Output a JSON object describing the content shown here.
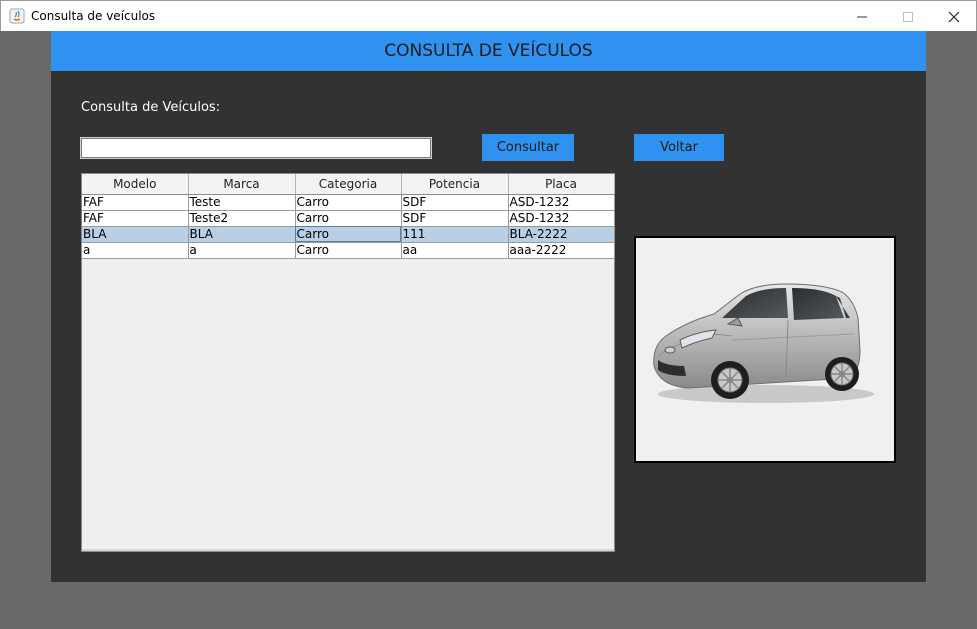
{
  "window": {
    "title": "Consulta de veículos"
  },
  "header": {
    "title": "CONSULTA DE VEÍCULOS"
  },
  "form": {
    "label": "Consulta de Veículos:",
    "search_value": "",
    "consultar_label": "Consultar",
    "voltar_label": "Voltar"
  },
  "table": {
    "columns": [
      "Modelo",
      "Marca",
      "Categoria",
      "Potencia",
      "Placa"
    ],
    "rows": [
      [
        "FAF",
        "Teste",
        "Carro",
        "SDF",
        "ASD-1232"
      ],
      [
        "FAF",
        "Teste2",
        "Carro",
        "SDF",
        "ASD-1232"
      ],
      [
        "BLA",
        "BLA",
        "Carro",
        "111",
        "BLA-2222"
      ],
      [
        "a",
        "a",
        "Carro",
        "aa",
        "aaa-2222"
      ]
    ],
    "selected_row": 2
  },
  "image": {
    "subject": "silver-hatchback-car"
  },
  "colors": {
    "accent": "#2f91f0",
    "panel": "#323232",
    "selection": "#b8cfe5"
  }
}
